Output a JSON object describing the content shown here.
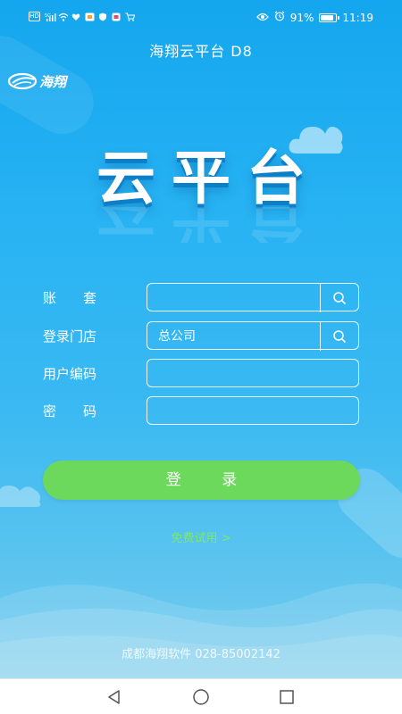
{
  "status_bar": {
    "left_badges": [
      "HD",
      "5G"
    ],
    "battery_percent": "91%",
    "battery_level": 0.91,
    "time": "11:19"
  },
  "app": {
    "title": "海翔云平台 D8",
    "brand_text": "海翔",
    "hero_title": "云平台"
  },
  "form": {
    "account_label": "账　　套",
    "account_value": "",
    "store_label": "登录门店",
    "store_value": "总公司",
    "usercode_label": "用户编码",
    "usercode_value": "",
    "password_label": "密　　码",
    "password_value": ""
  },
  "actions": {
    "login_label": "登 录",
    "free_trial_label": "免费试用 >"
  },
  "footer": {
    "company": "成都海翔软件 028-85002142"
  },
  "colors": {
    "background_top": "#14a6ee",
    "background_bottom": "#7ccdec",
    "login_button": "#6cd95c",
    "free_trial": "#7de86c",
    "text": "#ffffff"
  },
  "icons": {
    "search": "search-icon",
    "back": "nav-back-icon",
    "home": "nav-home-icon",
    "recents": "nav-recents-icon"
  }
}
